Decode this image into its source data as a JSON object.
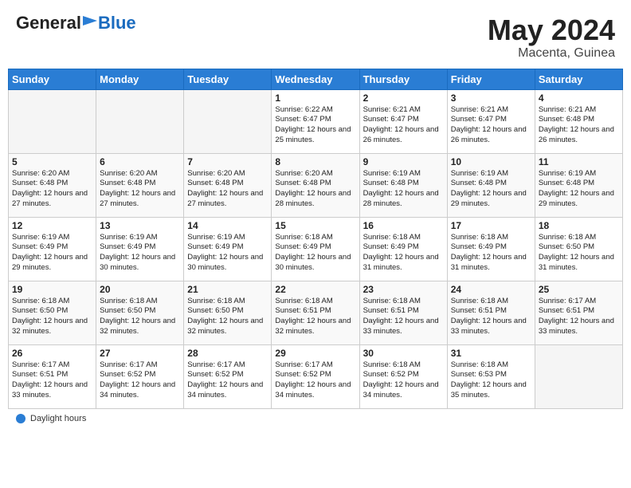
{
  "header": {
    "logo_general": "General",
    "logo_blue": "Blue",
    "month_title": "May 2024",
    "location": "Macenta, Guinea"
  },
  "footer": {
    "label": "Daylight hours"
  },
  "days_of_week": [
    "Sunday",
    "Monday",
    "Tuesday",
    "Wednesday",
    "Thursday",
    "Friday",
    "Saturday"
  ],
  "weeks": [
    [
      {
        "day": "",
        "sunrise": "",
        "sunset": "",
        "daylight": "",
        "empty": true
      },
      {
        "day": "",
        "sunrise": "",
        "sunset": "",
        "daylight": "",
        "empty": true
      },
      {
        "day": "",
        "sunrise": "",
        "sunset": "",
        "daylight": "",
        "empty": true
      },
      {
        "day": "1",
        "sunrise": "Sunrise: 6:22 AM",
        "sunset": "Sunset: 6:47 PM",
        "daylight": "Daylight: 12 hours and 25 minutes.",
        "empty": false
      },
      {
        "day": "2",
        "sunrise": "Sunrise: 6:21 AM",
        "sunset": "Sunset: 6:47 PM",
        "daylight": "Daylight: 12 hours and 26 minutes.",
        "empty": false
      },
      {
        "day": "3",
        "sunrise": "Sunrise: 6:21 AM",
        "sunset": "Sunset: 6:47 PM",
        "daylight": "Daylight: 12 hours and 26 minutes.",
        "empty": false
      },
      {
        "day": "4",
        "sunrise": "Sunrise: 6:21 AM",
        "sunset": "Sunset: 6:48 PM",
        "daylight": "Daylight: 12 hours and 26 minutes.",
        "empty": false
      }
    ],
    [
      {
        "day": "5",
        "sunrise": "Sunrise: 6:20 AM",
        "sunset": "Sunset: 6:48 PM",
        "daylight": "Daylight: 12 hours and 27 minutes.",
        "empty": false
      },
      {
        "day": "6",
        "sunrise": "Sunrise: 6:20 AM",
        "sunset": "Sunset: 6:48 PM",
        "daylight": "Daylight: 12 hours and 27 minutes.",
        "empty": false
      },
      {
        "day": "7",
        "sunrise": "Sunrise: 6:20 AM",
        "sunset": "Sunset: 6:48 PM",
        "daylight": "Daylight: 12 hours and 27 minutes.",
        "empty": false
      },
      {
        "day": "8",
        "sunrise": "Sunrise: 6:20 AM",
        "sunset": "Sunset: 6:48 PM",
        "daylight": "Daylight: 12 hours and 28 minutes.",
        "empty": false
      },
      {
        "day": "9",
        "sunrise": "Sunrise: 6:19 AM",
        "sunset": "Sunset: 6:48 PM",
        "daylight": "Daylight: 12 hours and 28 minutes.",
        "empty": false
      },
      {
        "day": "10",
        "sunrise": "Sunrise: 6:19 AM",
        "sunset": "Sunset: 6:48 PM",
        "daylight": "Daylight: 12 hours and 29 minutes.",
        "empty": false
      },
      {
        "day": "11",
        "sunrise": "Sunrise: 6:19 AM",
        "sunset": "Sunset: 6:48 PM",
        "daylight": "Daylight: 12 hours and 29 minutes.",
        "empty": false
      }
    ],
    [
      {
        "day": "12",
        "sunrise": "Sunrise: 6:19 AM",
        "sunset": "Sunset: 6:49 PM",
        "daylight": "Daylight: 12 hours and 29 minutes.",
        "empty": false
      },
      {
        "day": "13",
        "sunrise": "Sunrise: 6:19 AM",
        "sunset": "Sunset: 6:49 PM",
        "daylight": "Daylight: 12 hours and 30 minutes.",
        "empty": false
      },
      {
        "day": "14",
        "sunrise": "Sunrise: 6:19 AM",
        "sunset": "Sunset: 6:49 PM",
        "daylight": "Daylight: 12 hours and 30 minutes.",
        "empty": false
      },
      {
        "day": "15",
        "sunrise": "Sunrise: 6:18 AM",
        "sunset": "Sunset: 6:49 PM",
        "daylight": "Daylight: 12 hours and 30 minutes.",
        "empty": false
      },
      {
        "day": "16",
        "sunrise": "Sunrise: 6:18 AM",
        "sunset": "Sunset: 6:49 PM",
        "daylight": "Daylight: 12 hours and 31 minutes.",
        "empty": false
      },
      {
        "day": "17",
        "sunrise": "Sunrise: 6:18 AM",
        "sunset": "Sunset: 6:49 PM",
        "daylight": "Daylight: 12 hours and 31 minutes.",
        "empty": false
      },
      {
        "day": "18",
        "sunrise": "Sunrise: 6:18 AM",
        "sunset": "Sunset: 6:50 PM",
        "daylight": "Daylight: 12 hours and 31 minutes.",
        "empty": false
      }
    ],
    [
      {
        "day": "19",
        "sunrise": "Sunrise: 6:18 AM",
        "sunset": "Sunset: 6:50 PM",
        "daylight": "Daylight: 12 hours and 32 minutes.",
        "empty": false
      },
      {
        "day": "20",
        "sunrise": "Sunrise: 6:18 AM",
        "sunset": "Sunset: 6:50 PM",
        "daylight": "Daylight: 12 hours and 32 minutes.",
        "empty": false
      },
      {
        "day": "21",
        "sunrise": "Sunrise: 6:18 AM",
        "sunset": "Sunset: 6:50 PM",
        "daylight": "Daylight: 12 hours and 32 minutes.",
        "empty": false
      },
      {
        "day": "22",
        "sunrise": "Sunrise: 6:18 AM",
        "sunset": "Sunset: 6:51 PM",
        "daylight": "Daylight: 12 hours and 32 minutes.",
        "empty": false
      },
      {
        "day": "23",
        "sunrise": "Sunrise: 6:18 AM",
        "sunset": "Sunset: 6:51 PM",
        "daylight": "Daylight: 12 hours and 33 minutes.",
        "empty": false
      },
      {
        "day": "24",
        "sunrise": "Sunrise: 6:18 AM",
        "sunset": "Sunset: 6:51 PM",
        "daylight": "Daylight: 12 hours and 33 minutes.",
        "empty": false
      },
      {
        "day": "25",
        "sunrise": "Sunrise: 6:17 AM",
        "sunset": "Sunset: 6:51 PM",
        "daylight": "Daylight: 12 hours and 33 minutes.",
        "empty": false
      }
    ],
    [
      {
        "day": "26",
        "sunrise": "Sunrise: 6:17 AM",
        "sunset": "Sunset: 6:51 PM",
        "daylight": "Daylight: 12 hours and 33 minutes.",
        "empty": false
      },
      {
        "day": "27",
        "sunrise": "Sunrise: 6:17 AM",
        "sunset": "Sunset: 6:52 PM",
        "daylight": "Daylight: 12 hours and 34 minutes.",
        "empty": false
      },
      {
        "day": "28",
        "sunrise": "Sunrise: 6:17 AM",
        "sunset": "Sunset: 6:52 PM",
        "daylight": "Daylight: 12 hours and 34 minutes.",
        "empty": false
      },
      {
        "day": "29",
        "sunrise": "Sunrise: 6:17 AM",
        "sunset": "Sunset: 6:52 PM",
        "daylight": "Daylight: 12 hours and 34 minutes.",
        "empty": false
      },
      {
        "day": "30",
        "sunrise": "Sunrise: 6:18 AM",
        "sunset": "Sunset: 6:52 PM",
        "daylight": "Daylight: 12 hours and 34 minutes.",
        "empty": false
      },
      {
        "day": "31",
        "sunrise": "Sunrise: 6:18 AM",
        "sunset": "Sunset: 6:53 PM",
        "daylight": "Daylight: 12 hours and 35 minutes.",
        "empty": false
      },
      {
        "day": "",
        "sunrise": "",
        "sunset": "",
        "daylight": "",
        "empty": true
      }
    ]
  ]
}
